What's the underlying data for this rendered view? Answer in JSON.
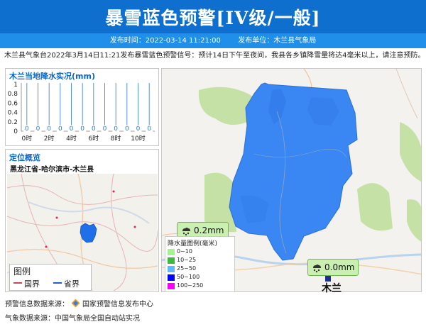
{
  "header": {
    "title": "暴雪蓝色预警[IV级/一般]",
    "publish_time_label": "发布时间：",
    "publish_time": "2022-03-14 11:21:00",
    "publisher_label": "发布单位：",
    "publisher": "木兰县气象局"
  },
  "description": "木兰县气象台2022年3月14日11:21发布暴雪蓝色预警信号：预计14日下午至夜间，我县各乡镇降雪量将达4毫米以上，请注意预防。",
  "chart": {
    "title": "木兰当地降水实况(mm)",
    "chart_data": {
      "type": "bar",
      "title": "木兰当地降水实况(mm)",
      "ylim": [
        0,
        1
      ],
      "y_ticks": [
        "1",
        "0.8",
        "0.6",
        "0.4",
        "0.2",
        "0"
      ],
      "x_ticks": [
        "0时",
        "2时",
        "4时",
        "6时",
        "8时",
        "10时"
      ],
      "categories": [
        0,
        1,
        2,
        3,
        4,
        5,
        6,
        7,
        8,
        9,
        10,
        11
      ],
      "values": [
        0,
        0,
        0,
        0,
        0,
        0,
        0,
        0,
        0,
        0,
        0,
        0
      ],
      "data_labels": [
        "0",
        "0",
        "0",
        "0",
        "0",
        "0",
        "0",
        "0",
        "0",
        "0",
        "0",
        "0"
      ],
      "grid": false
    }
  },
  "location": {
    "title": "定位概览",
    "region": "黑龙江省-哈尔滨市-木兰县",
    "legend": {
      "title": "图例",
      "items": [
        {
          "label": "国界",
          "color": "#c8475a"
        },
        {
          "label": "省界",
          "color": "#1f5fd1"
        }
      ]
    }
  },
  "map": {
    "bubble_left": "0.2mm",
    "bubble_right": "0.0mm",
    "town": "木兰",
    "rain_legend": {
      "title": "降水量图例(毫米)",
      "items": [
        {
          "label": "0~10",
          "color": "#a6f28f"
        },
        {
          "label": "10~25",
          "color": "#3dba3d"
        },
        {
          "label": "25~50",
          "color": "#61b8ff"
        },
        {
          "label": "50~100",
          "color": "#0000ff"
        },
        {
          "label": "100~250",
          "color": "#fa00fa"
        }
      ]
    }
  },
  "footer": {
    "warning_source_label": "预警信息数据来源：",
    "warning_source": "国家预警信息发布中心",
    "weather_source": "气象数据来源：中国气象局全国自动站实况"
  }
}
